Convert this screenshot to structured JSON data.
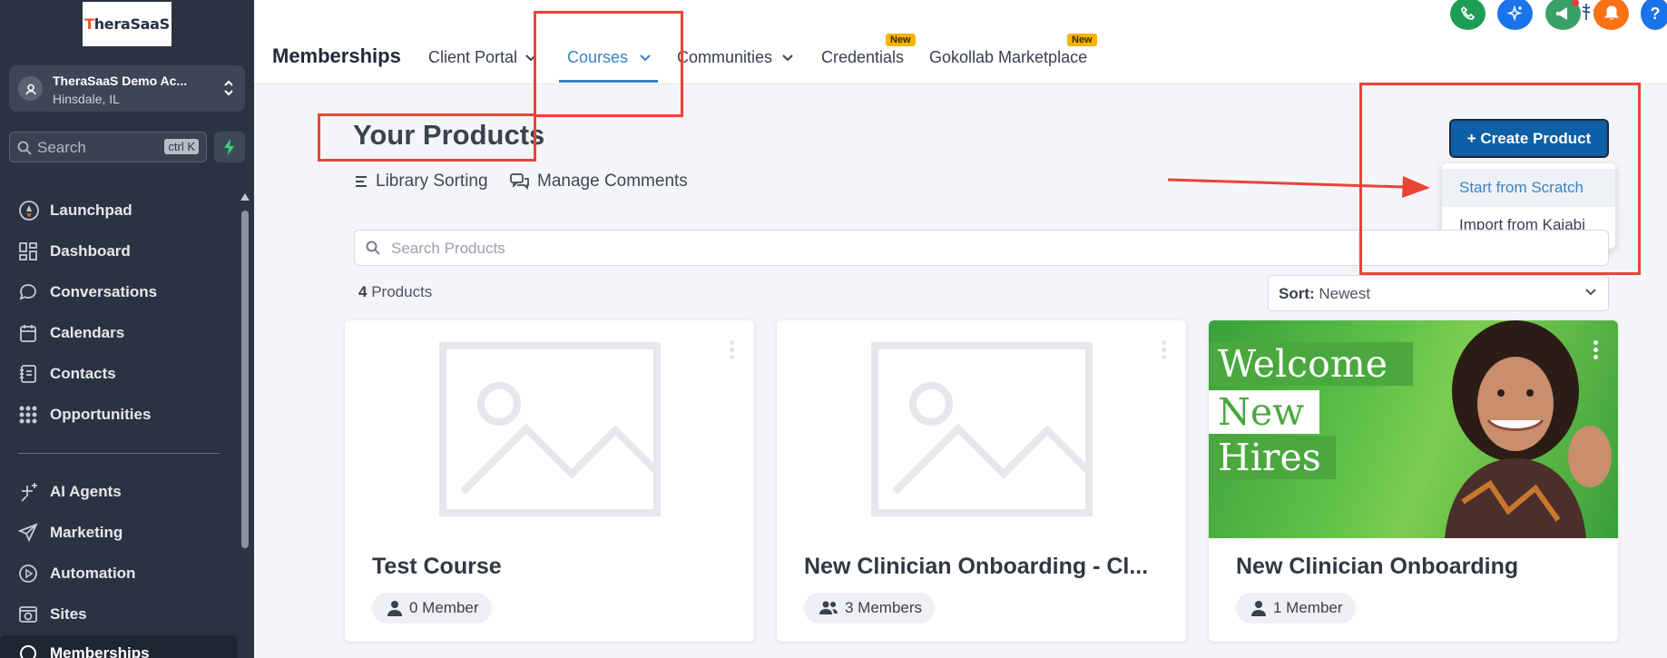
{
  "sidebar": {
    "logo_text": "TheraSaaS",
    "account": {
      "name": "TheraSaaS Demo Ac...",
      "location": "Hinsdale, IL"
    },
    "search": {
      "placeholder": "Search",
      "shortcut": "ctrl K"
    },
    "items": [
      {
        "label": "Launchpad",
        "icon": "rocket-icon"
      },
      {
        "label": "Dashboard",
        "icon": "dashboard-grid-icon"
      },
      {
        "label": "Conversations",
        "icon": "chat-bubble-icon"
      },
      {
        "label": "Calendars",
        "icon": "calendar-icon"
      },
      {
        "label": "Contacts",
        "icon": "contacts-book-icon"
      },
      {
        "label": "Opportunities",
        "icon": "opportunities-icon"
      },
      {
        "label": "AI Agents",
        "icon": "sparkle-icon"
      },
      {
        "label": "Marketing",
        "icon": "send-icon"
      },
      {
        "label": "Automation",
        "icon": "automation-icon"
      },
      {
        "label": "Sites",
        "icon": "globe-icon"
      },
      {
        "label": "Memberships",
        "icon": "memberships-icon"
      }
    ]
  },
  "header": {
    "title": "Memberships",
    "tabs": [
      {
        "label": "Client Portal"
      },
      {
        "label": "Courses"
      },
      {
        "label": "Communities"
      },
      {
        "label": "Credentials",
        "badge": "New"
      },
      {
        "label": "Gokollab Marketplace",
        "badge": "New"
      }
    ],
    "icons": [
      {
        "name": "phone-icon",
        "color": "#1f9d55"
      },
      {
        "name": "ai-sparkle-icon",
        "color": "#1a73e8"
      },
      {
        "name": "megaphone-icon",
        "color": "#38a169"
      },
      {
        "name": "bell-icon",
        "color": "#f97316"
      },
      {
        "name": "help-icon",
        "color": "#1a73e8"
      }
    ]
  },
  "main": {
    "heading": "Your Products",
    "library_sorting": "Library Sorting",
    "manage_comments": "Manage Comments",
    "create_button": "+ Create Product",
    "dropdown": [
      "Start from Scratch",
      "Import from Kajabi"
    ],
    "search_placeholder": "Search Products",
    "count_number": "4",
    "count_label": "Products",
    "sort_label": "Sort:",
    "sort_value": "Newest",
    "cards": [
      {
        "title": "Test Course",
        "members": "0 Member"
      },
      {
        "title": "New Clinician Onboarding - Cl...",
        "members": "3 Members"
      },
      {
        "title": "New Clinician Onboarding",
        "members": "1 Member",
        "image_text": [
          "Welcome",
          "New",
          "Hires"
        ]
      }
    ]
  },
  "colors": {
    "accent": "#3b82c4",
    "primary_button": "#0d5fa8",
    "annotation": "#ea4335",
    "sidebar_bg": "#2b3342"
  }
}
